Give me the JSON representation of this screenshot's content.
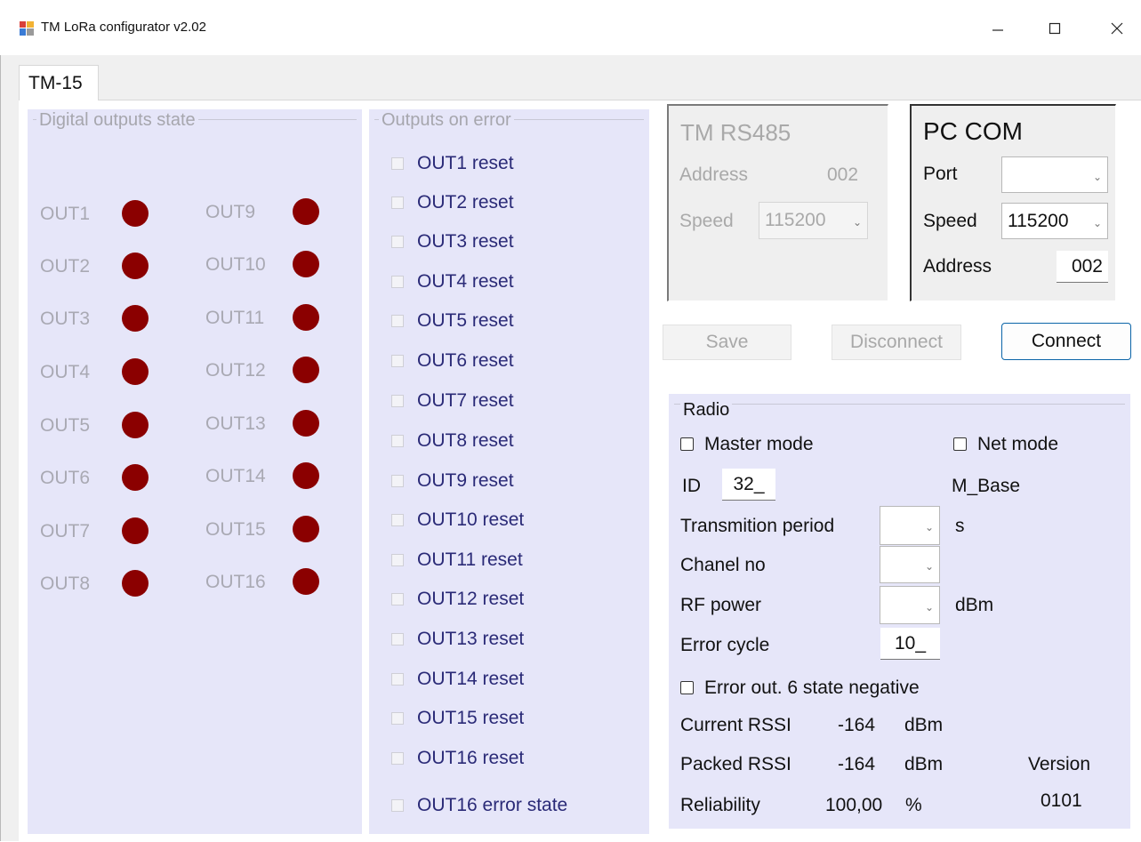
{
  "window": {
    "title": "TM LoRa configurator v2.02",
    "controls": {
      "minimize": "minimize-icon",
      "maximize": "maximize-icon",
      "close": "close-icon"
    }
  },
  "tabs": [
    {
      "label": "TM-15",
      "selected": true
    }
  ],
  "digital_outputs": {
    "title": "Digital outputs state",
    "outputs": [
      {
        "label": "OUT1",
        "state": "dark-red"
      },
      {
        "label": "OUT2",
        "state": "dark-red"
      },
      {
        "label": "OUT3",
        "state": "dark-red"
      },
      {
        "label": "OUT4",
        "state": "dark-red"
      },
      {
        "label": "OUT5",
        "state": "dark-red"
      },
      {
        "label": "OUT6",
        "state": "dark-red"
      },
      {
        "label": "OUT7",
        "state": "dark-red"
      },
      {
        "label": "OUT8",
        "state": "dark-red"
      },
      {
        "label": "OUT9",
        "state": "dark-red"
      },
      {
        "label": "OUT10",
        "state": "dark-red"
      },
      {
        "label": "OUT11",
        "state": "dark-red"
      },
      {
        "label": "OUT12",
        "state": "dark-red"
      },
      {
        "label": "OUT13",
        "state": "dark-red"
      },
      {
        "label": "OUT14",
        "state": "dark-red"
      },
      {
        "label": "OUT15",
        "state": "dark-red"
      },
      {
        "label": "OUT16",
        "state": "dark-red"
      }
    ]
  },
  "outputs_on_error": {
    "title": "Outputs on error",
    "items": [
      {
        "label": "OUT1 reset",
        "checked": false
      },
      {
        "label": "OUT2 reset",
        "checked": false
      },
      {
        "label": "OUT3 reset",
        "checked": false
      },
      {
        "label": "OUT4 reset",
        "checked": false
      },
      {
        "label": "OUT5 reset",
        "checked": false
      },
      {
        "label": "OUT6 reset",
        "checked": false
      },
      {
        "label": "OUT7 reset",
        "checked": false
      },
      {
        "label": "OUT8 reset",
        "checked": false
      },
      {
        "label": "OUT9 reset",
        "checked": false
      },
      {
        "label": "OUT10 reset",
        "checked": false
      },
      {
        "label": "OUT11 reset",
        "checked": false
      },
      {
        "label": "OUT12 reset",
        "checked": false
      },
      {
        "label": "OUT13 reset",
        "checked": false
      },
      {
        "label": "OUT14 reset",
        "checked": false
      },
      {
        "label": "OUT15 reset",
        "checked": false
      },
      {
        "label": "OUT16 reset",
        "checked": false
      },
      {
        "label": "OUT16 error state",
        "checked": false
      }
    ]
  },
  "tm_rs485": {
    "title": "TM RS485",
    "address_label": "Address",
    "address_value": "002",
    "speed_label": "Speed",
    "speed_value": "115200"
  },
  "pc_com": {
    "title": "PC COM",
    "port_label": "Port",
    "port_value": "",
    "speed_label": "Speed",
    "speed_value": "115200",
    "address_label": "Address",
    "address_value": "002"
  },
  "buttons": {
    "save": "Save",
    "disconnect": "Disconnect",
    "connect": "Connect"
  },
  "radio": {
    "title": "Radio",
    "master_mode": {
      "label": "Master mode",
      "checked": false
    },
    "net_mode": {
      "label": "Net mode",
      "checked": false
    },
    "id_label": "ID",
    "id_value": "32_",
    "base_name": "M_Base",
    "transmition_period_label": "Transmition period",
    "transmition_period_value": "",
    "transmition_period_unit": "s",
    "chanel_no_label": "Chanel no",
    "chanel_no_value": "",
    "rf_power_label": "RF power",
    "rf_power_value": "",
    "rf_power_unit": "dBm",
    "error_cycle_label": "Error cycle",
    "error_cycle_value": "10_",
    "error_out_negative": {
      "label": "Error out. 6 state negative",
      "checked": false
    },
    "current_rssi_label": "Current RSSI",
    "current_rssi_value": "-164",
    "current_rssi_unit": "dBm",
    "packed_rssi_label": "Packed RSSI",
    "packed_rssi_value": "-164",
    "packed_rssi_unit": "dBm",
    "reliability_label": "Reliability",
    "reliability_value": "100,00",
    "reliability_unit": "%",
    "version_label": "Version",
    "version_value": "0101"
  },
  "colors": {
    "group_background": "#e6e6f9",
    "led_color": "#8b0000",
    "checkbox_text": "#2a2a77",
    "disabled_text": "#a9a9b3",
    "connect_border": "#0a64a8"
  }
}
